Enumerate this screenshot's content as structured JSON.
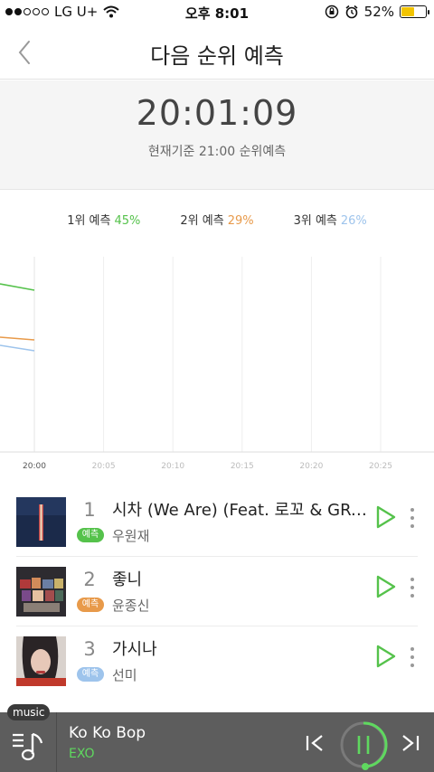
{
  "status_bar": {
    "carrier": "LG U+",
    "time": "오후 8:01",
    "battery": "52%",
    "battery_level": 0.52
  },
  "nav": {
    "title": "다음 순위 예측"
  },
  "timer": {
    "clock": "20:01:09",
    "subtitle": "현재기준 21:00 순위예측"
  },
  "legend": [
    {
      "label": "1위 예측",
      "pct": "45%",
      "color": "#55c24b"
    },
    {
      "label": "2위 예측",
      "pct": "29%",
      "color": "#e89a4a"
    },
    {
      "label": "3위 예측",
      "pct": "26%",
      "color": "#9ec4ec"
    }
  ],
  "chart_data": {
    "type": "line",
    "x": [
      "20:00",
      "20:05",
      "20:10",
      "20:15",
      "20:20",
      "20:25"
    ],
    "series": [
      {
        "name": "1위 예측",
        "color": "#55c24b"
      },
      {
        "name": "2위 예측",
        "color": "#e89a4a"
      },
      {
        "name": "3위 예측",
        "color": "#9ec4ec"
      }
    ]
  },
  "songs": [
    {
      "rank": "1",
      "badge": "예측",
      "badge_color": "#55c24b",
      "title": "시차 (We Are) (Feat. 로꼬 & GRAY)",
      "artist": "우원재"
    },
    {
      "rank": "2",
      "badge": "예측",
      "badge_color": "#e89a4a",
      "title": "좋니",
      "artist": "윤종신"
    },
    {
      "rank": "3",
      "badge": "예측",
      "badge_color": "#9ec4ec",
      "title": "가시나",
      "artist": "선미"
    }
  ],
  "player": {
    "tab": "music",
    "title": "Ko Ko Bop",
    "artist": "EXO",
    "accent": "#5fd85f"
  }
}
